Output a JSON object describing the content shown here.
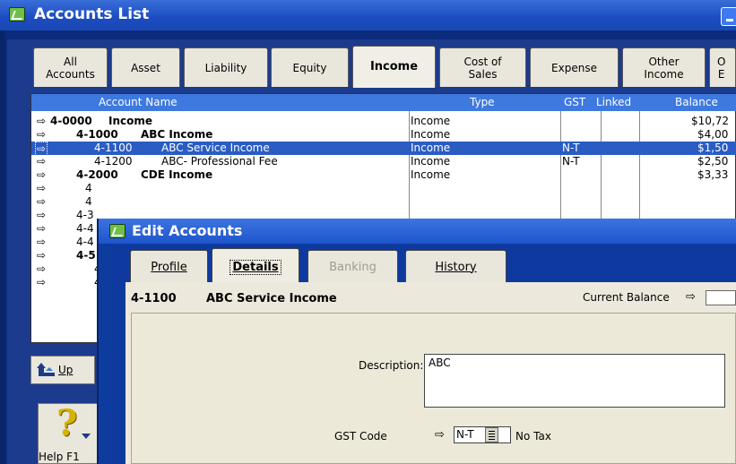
{
  "accounts_window": {
    "title": "Accounts List",
    "tabs": [
      {
        "label": "All\nAccounts"
      },
      {
        "label": "Asset"
      },
      {
        "label": "Liability"
      },
      {
        "label": "Equity"
      },
      {
        "label": "Income"
      },
      {
        "label": "Cost of\nSales"
      },
      {
        "label": "Expense"
      },
      {
        "label": "Other\nIncome"
      },
      {
        "label": "O\nE"
      }
    ],
    "active_tab": "Income",
    "columns": {
      "account_name": "Account Name",
      "type": "Type",
      "gst": "GST",
      "linked": "Linked",
      "balance": "Balance"
    },
    "rows": [
      {
        "number": "4-0000",
        "name": "Income",
        "type": "Income",
        "gst": "",
        "balance": "$10,72"
      },
      {
        "number": "4-1000",
        "name": "ABC Income",
        "type": "Income",
        "gst": "",
        "balance": "$4,00"
      },
      {
        "number": "4-1100",
        "name": "ABC Service Income",
        "type": "Income",
        "gst": "N-T",
        "balance": "$1,50"
      },
      {
        "number": "4-1200",
        "name": "ABC- Professional Fee",
        "type": "Income",
        "gst": "N-T",
        "balance": "$2,50"
      },
      {
        "number": "4-2000",
        "name": "CDE Income",
        "type": "Income",
        "gst": "",
        "balance": "$3,33"
      },
      {
        "number": "4",
        "name": "",
        "type": "",
        "gst": "",
        "balance": ""
      },
      {
        "number": "4",
        "name": "",
        "type": "",
        "gst": "",
        "balance": ""
      },
      {
        "number": "4-3",
        "name": "",
        "type": "",
        "gst": "",
        "balance": ""
      },
      {
        "number": "4-4",
        "name": "",
        "type": "",
        "gst": "",
        "balance": ""
      },
      {
        "number": "4-4",
        "name": "",
        "type": "",
        "gst": "",
        "balance": ""
      },
      {
        "number": "4-5",
        "name": "",
        "type": "",
        "gst": "",
        "balance": ""
      },
      {
        "number": "4",
        "name": "",
        "type": "",
        "gst": "",
        "balance": ""
      },
      {
        "number": "4",
        "name": "",
        "type": "",
        "gst": "",
        "balance": ""
      }
    ],
    "selected_row": "4-1100",
    "up_label": "Up",
    "help_label": "Help F1"
  },
  "edit_window": {
    "title": "Edit Accounts",
    "tabs": [
      {
        "label": "Profile",
        "state": "normal"
      },
      {
        "label": "Details",
        "state": "active"
      },
      {
        "label": "Banking",
        "state": "disabled"
      },
      {
        "label": "History",
        "state": "normal"
      }
    ],
    "account_number": "4-1100",
    "account_name": "ABC Service Income",
    "current_balance_label": "Current Balance",
    "description_label": "Description:",
    "description_value": "ABC",
    "gst_code_label": "GST Code",
    "gst_code_value": "N-T",
    "gst_code_text": "No Tax"
  },
  "colors": {
    "titlebar": "#1f55cc",
    "selection": "#2a5cc4",
    "header": "#3d79df",
    "panel": "#ece9dc"
  },
  "icons": {
    "row_arrow": "right-arrow-icon",
    "up": "up-arrow-icon",
    "help": "question-mark-icon",
    "window": "window-app-icon",
    "dropdown": "list-dropdown-icon"
  }
}
